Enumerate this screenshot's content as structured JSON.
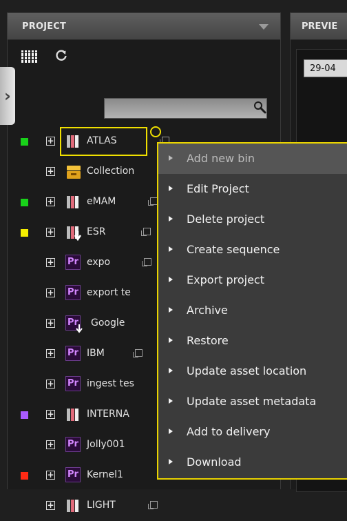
{
  "project_panel": {
    "title": "PROJECT"
  },
  "preview_panel": {
    "title": "PREVIE",
    "date": "29-04"
  },
  "search": {
    "value": "",
    "placeholder": ""
  },
  "tree": {
    "items": [
      {
        "label": "ATLAS",
        "tag_color": "#19d21a",
        "icon": "bin-folder-icon",
        "selected": true,
        "link_icon": true
      },
      {
        "label": "Collection",
        "tag_color": "",
        "icon": "collection-drawer-icon",
        "selected": false,
        "link_icon": false
      },
      {
        "label": "eMAM",
        "tag_color": "#19d21a",
        "icon": "bin-folder-icon",
        "selected": false,
        "link_icon": true
      },
      {
        "label": "ESR",
        "tag_color": "#f5ee00",
        "icon": "bin-download-icon",
        "selected": false,
        "link_icon": true
      },
      {
        "label": "expo",
        "tag_color": "",
        "icon": "premiere-icon",
        "selected": false,
        "link_icon": true
      },
      {
        "label": "export te",
        "tag_color": "",
        "icon": "premiere-icon",
        "selected": false,
        "link_icon": false
      },
      {
        "label": "Google",
        "tag_color": "",
        "icon": "premiere-download-icon",
        "selected": false,
        "link_icon": false
      },
      {
        "label": "IBM",
        "tag_color": "",
        "icon": "premiere-icon",
        "selected": false,
        "link_icon": true
      },
      {
        "label": "ingest tes",
        "tag_color": "",
        "icon": "premiere-icon",
        "selected": false,
        "link_icon": false
      },
      {
        "label": "INTERNA",
        "tag_color": "#a95bff",
        "icon": "bin-folder-icon",
        "selected": false,
        "link_icon": false
      },
      {
        "label": "Jolly001",
        "tag_color": "",
        "icon": "premiere-icon",
        "selected": false,
        "link_icon": false
      },
      {
        "label": "Kernel1",
        "tag_color": "#ff2a14",
        "icon": "premiere-icon",
        "selected": false,
        "link_icon": false
      },
      {
        "label": "LIGHT",
        "tag_color": "",
        "icon": "bin-folder-icon",
        "selected": false,
        "link_icon": true
      }
    ]
  },
  "context_menu": {
    "items": [
      {
        "label": "Add new bin",
        "disabled": true
      },
      {
        "label": "Edit Project",
        "disabled": false
      },
      {
        "label": "Delete project",
        "disabled": false
      },
      {
        "label": "Create sequence",
        "disabled": false
      },
      {
        "label": "Export project",
        "disabled": false
      },
      {
        "label": "Archive",
        "disabled": false
      },
      {
        "label": "Restore",
        "disabled": false
      },
      {
        "label": "Update asset location",
        "disabled": false
      },
      {
        "label": "Update asset metadata",
        "disabled": false
      },
      {
        "label": "Add to delivery",
        "disabled": false
      },
      {
        "label": "Download",
        "disabled": false
      }
    ]
  },
  "icons": {
    "grid": "grid-view-icon",
    "refresh": "refresh-icon",
    "search": "search-icon",
    "expand": "expand-plus-icon",
    "side_tab": "chevron-right-icon"
  }
}
